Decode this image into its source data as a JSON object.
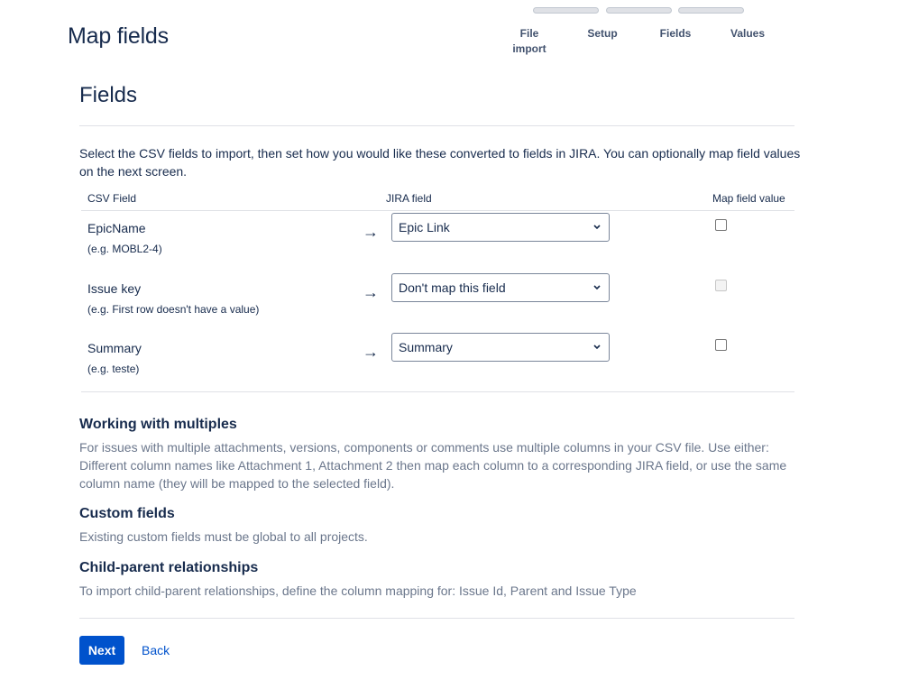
{
  "page": {
    "title": "Map fields"
  },
  "tracker": {
    "steps": [
      {
        "label": "File import"
      },
      {
        "label": "Setup"
      },
      {
        "label": "Fields"
      },
      {
        "label": "Values"
      }
    ]
  },
  "fields_section": {
    "title": "Fields",
    "intro": "Select the CSV fields to import, then set how you would like these converted to fields in JIRA. You can optionally map field values on the next screen.",
    "columns": {
      "csv": "CSV Field",
      "jira": "JIRA field",
      "map_value": "Map field value"
    },
    "rows": [
      {
        "name": "EpicName",
        "example": "(e.g.  MOBL2-4)",
        "jira_field": "Epic Link",
        "map_value_disabled": false
      },
      {
        "name": "Issue key",
        "example": "(e.g.  First row doesn't have a value)",
        "jira_field": "Don't map this field",
        "map_value_disabled": true
      },
      {
        "name": "Summary",
        "example": "(e.g.  teste)",
        "jira_field": "Summary",
        "map_value_disabled": false
      }
    ]
  },
  "help": {
    "multiples": {
      "title": "Working with multiples",
      "text": "For issues with multiple attachments, versions, components or comments use multiple columns in your CSV file. Use either: Different column names like Attachment 1, Attachment 2 then map each column to a corresponding JIRA field, or use the same column name (they will be mapped to the selected field)."
    },
    "custom": {
      "title": "Custom fields",
      "text": "Existing custom fields must be global to all projects."
    },
    "child_parent": {
      "title": "Child-parent relationships",
      "text": "To import child-parent relationships, define the column mapping for: Issue Id, Parent and Issue Type"
    }
  },
  "actions": {
    "next_label": "Next",
    "back_label": "Back"
  },
  "colors": {
    "primary": "#0052cc",
    "text": "#172b4d",
    "muted": "#6b778c",
    "divider": "#dfe1e6"
  }
}
